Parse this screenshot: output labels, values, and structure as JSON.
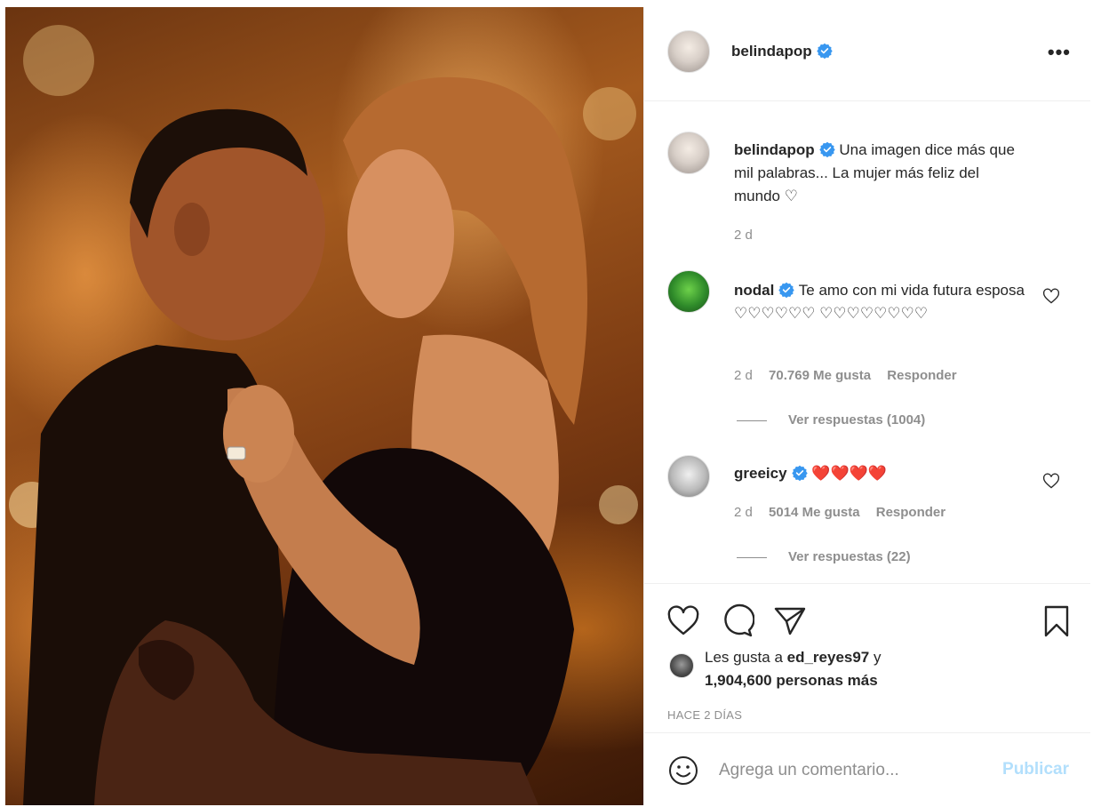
{
  "post": {
    "author": "belindapop",
    "more_icon": "more-horizontal-icon",
    "verified_color": "#3897f0"
  },
  "caption": {
    "author": "belindapop",
    "text": "Una imagen dice más que mil palabras... La mujer más feliz del mundo ♡",
    "time": "2 d"
  },
  "comments": [
    {
      "author": "nodal",
      "text": "Te amo con mi vida futura esposa ♡♡♡♡♡♡ ♡♡♡♡♡♡♡♡",
      "time": "2 d",
      "likes": "70.769 Me gusta",
      "reply": "Responder",
      "view_replies": "Ver respuestas (1004)"
    },
    {
      "author": "greeicy",
      "text": "❤️❤️❤️❤️",
      "time": "2 d",
      "likes": "5014 Me gusta",
      "reply": "Responder",
      "view_replies": "Ver respuestas (22)"
    }
  ],
  "likes_summary": {
    "prefix": "Les gusta a ",
    "user": "ed_reyes97",
    "conj": " y",
    "others": "1,904,600 personas más"
  },
  "time_ago": "HACE 2 DÍAS",
  "composer": {
    "placeholder": "Agrega un comentario...",
    "publish": "Publicar",
    "publish_color": "#b2dffc"
  }
}
